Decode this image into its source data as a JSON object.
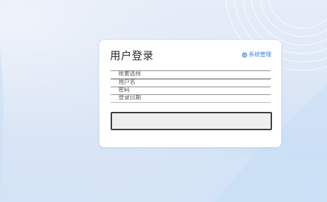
{
  "login": {
    "title": "用户登录",
    "system_link": {
      "icon": "gear-icon",
      "label": "系统管理"
    },
    "fields": [
      {
        "label": "账套选择"
      },
      {
        "label": "用户名"
      },
      {
        "label": "密码"
      },
      {
        "label": "登录日期"
      }
    ],
    "login_button_label": ""
  },
  "colors": {
    "accent": "#3a7de0",
    "background": "#dde7f6",
    "card": "#ffffff",
    "button_fill": "#efefef",
    "button_border": "#3c3c3c"
  }
}
